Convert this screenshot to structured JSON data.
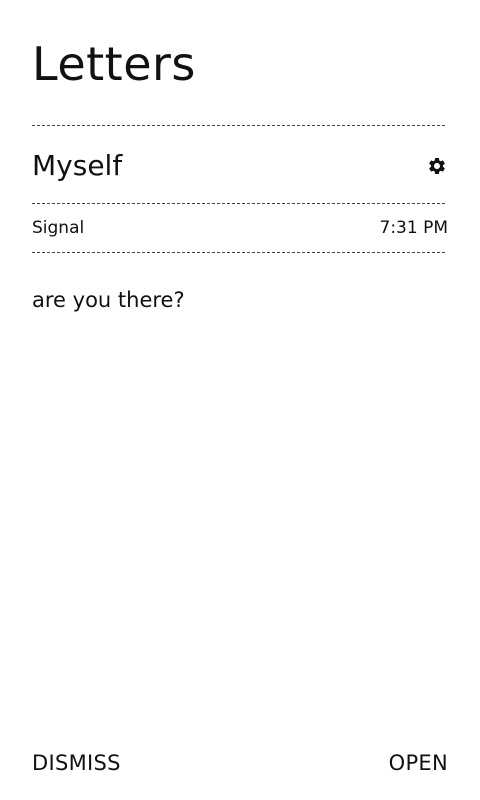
{
  "app": {
    "title": "Letters"
  },
  "notification": {
    "contact_name": "Myself",
    "settings_icon": "gear-icon",
    "source_app": "Signal",
    "time": "7:31 PM",
    "message": "are you there?"
  },
  "actions": {
    "dismiss_label": "DISMISS",
    "open_label": "OPEN"
  },
  "colors": {
    "background": "#ffffff",
    "text": "#111111",
    "divider": "#444444"
  }
}
